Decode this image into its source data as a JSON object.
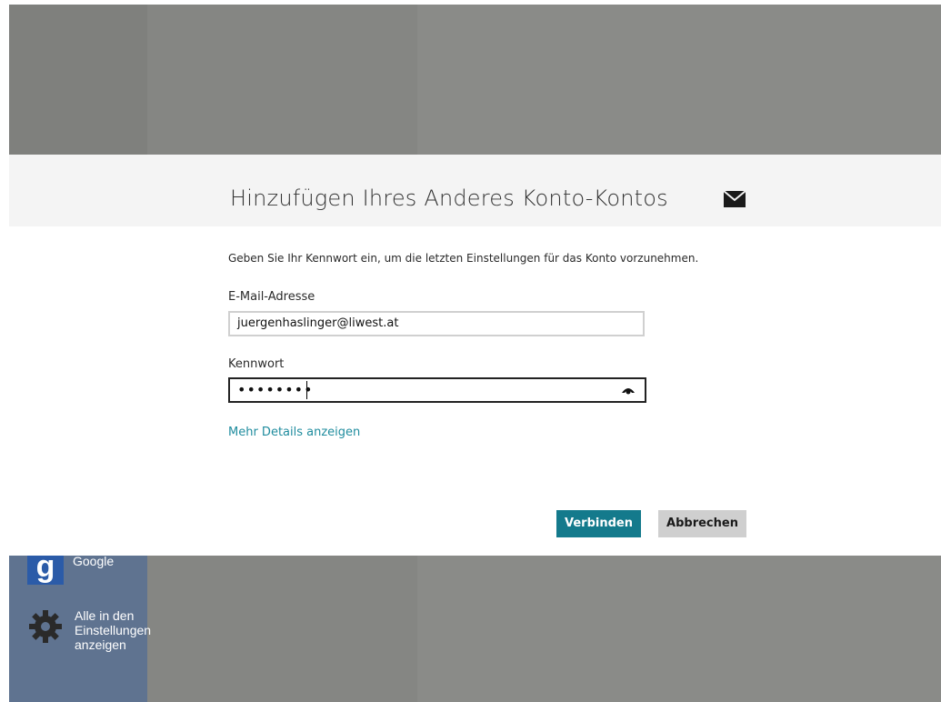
{
  "dialog": {
    "title": "Hinzufügen Ihres Anderes Konto-Kontos",
    "header_icon": "mail-icon",
    "instruction": "Geben Sie Ihr Kennwort ein, um die letzten Einstellungen für das Konto vorzunehmen.",
    "email": {
      "label": "E-Mail-Adresse",
      "value": "juergenhaslinger@liwest.at"
    },
    "password": {
      "label": "Kennwort",
      "masked_value": "••••••••",
      "reveal_icon": "eye-icon"
    },
    "more_details_link": "Mehr Details anzeigen",
    "connect_button": "Verbinden",
    "cancel_button": "Abbrechen"
  },
  "background": {
    "top_caption": "„ ",
    "side_items": [
      {
        "icon": "google-logo-icon",
        "label": "Google"
      },
      {
        "icon": "gear-icon",
        "label": "Alle in den Einstellungen anzeigen"
      }
    ]
  },
  "colors": {
    "accent": "#147a8c",
    "link": "#1f8c9e",
    "overlay": "#8a8b88",
    "header_band": "#f4f4f4"
  }
}
